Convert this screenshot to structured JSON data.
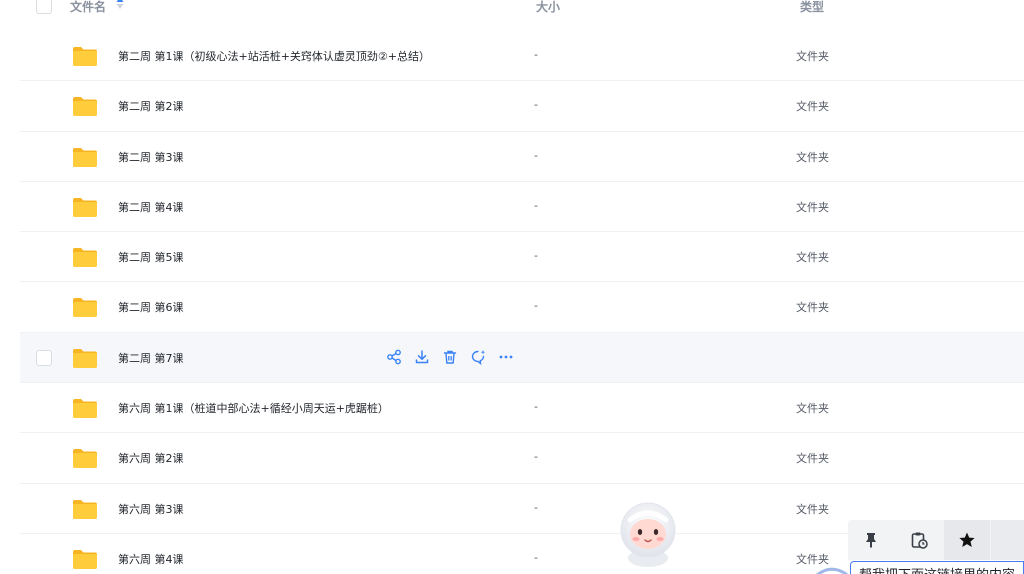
{
  "columns": {
    "name": "文件名",
    "size": "大小",
    "type": "类型"
  },
  "rows": [
    {
      "name": "第二周 第1课（初级心法+站活桩+关窍体认虚灵顶劲②+总结）",
      "size": "-",
      "type": "文件夹"
    },
    {
      "name": "第二周 第2课",
      "size": "-",
      "type": "文件夹"
    },
    {
      "name": "第二周 第3课",
      "size": "-",
      "type": "文件夹"
    },
    {
      "name": "第二周 第4课",
      "size": "-",
      "type": "文件夹"
    },
    {
      "name": "第二周 第5课",
      "size": "-",
      "type": "文件夹"
    },
    {
      "name": "第二周 第6课",
      "size": "-",
      "type": "文件夹"
    },
    {
      "name": "第二周 第7课",
      "size": "",
      "type": ""
    },
    {
      "name": "第六周 第1课（桩道中部心法+循经小周天运+虎踞桩）",
      "size": "-",
      "type": "文件夹"
    },
    {
      "name": "第六周 第2课",
      "size": "-",
      "type": "文件夹"
    },
    {
      "name": "第六周 第3课",
      "size": "-",
      "type": "文件夹"
    },
    {
      "name": "第六周 第4课",
      "size": "-",
      "type": "文件夹"
    }
  ],
  "hover_row_index": 6,
  "bottom_input": {
    "value": "帮我把下面这链接里的内容"
  },
  "colors": {
    "folder": "#ffc52f",
    "accent": "#3b82f6",
    "hover_bg": "#f5f7fa"
  }
}
